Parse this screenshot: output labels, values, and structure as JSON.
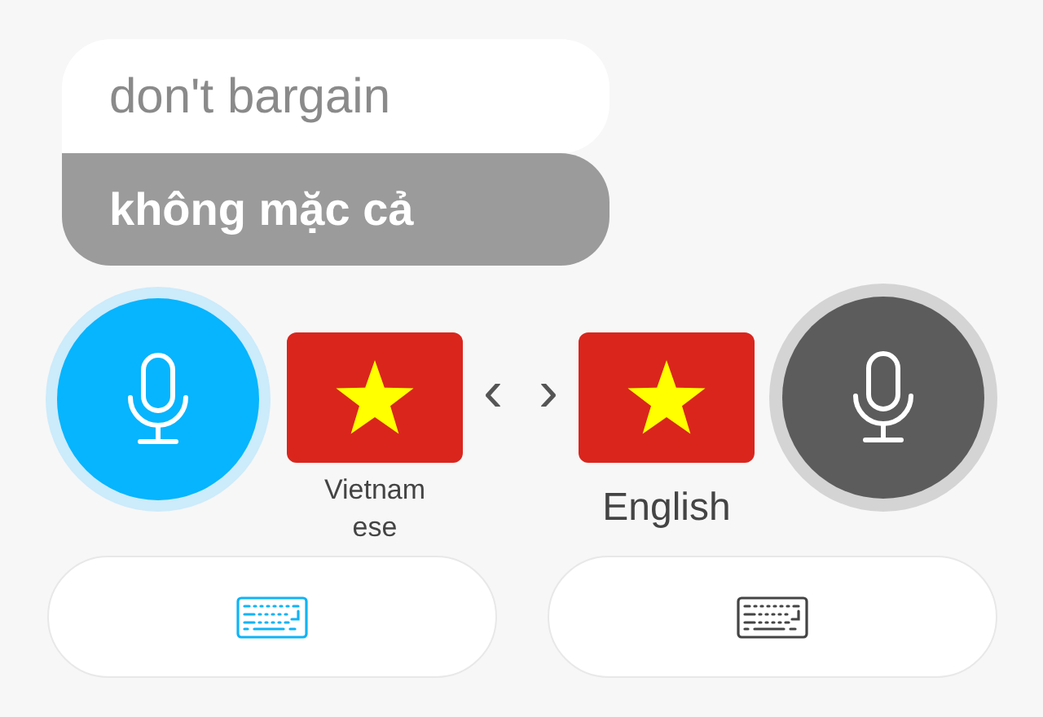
{
  "phrase": {
    "source": "don't bargain",
    "translation": "không mặc cả"
  },
  "sides": [
    {
      "language": "Vietnamese",
      "mic_active": true,
      "keyboard_active": true
    },
    {
      "language": "English",
      "mic_active": false,
      "keyboard_active": false
    }
  ],
  "swap": {
    "left": "‹",
    "right": "›"
  }
}
